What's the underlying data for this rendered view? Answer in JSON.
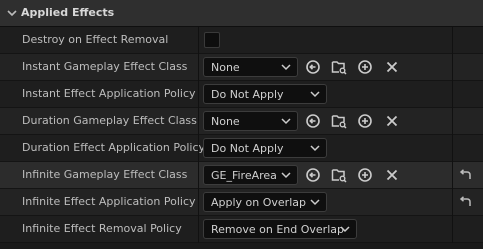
{
  "section": {
    "title": "Applied Effects"
  },
  "rows": [
    {
      "label": "Destroy on Effect Removal"
    },
    {
      "label": "Instant Gameplay Effect Class",
      "value": "None"
    },
    {
      "label": "Instant Effect Application Policy",
      "value": "Do Not Apply"
    },
    {
      "label": "Duration Gameplay Effect Class",
      "value": "None"
    },
    {
      "label": "Duration Effect Application Policy",
      "value": "Do Not Apply"
    },
    {
      "label": "Infinite Gameplay Effect Class",
      "value": "GE_FireArea"
    },
    {
      "label": "Infinite Effect Application Policy",
      "value": "Apply on Overlap"
    },
    {
      "label": "Infinite Effect Removal Policy",
      "value": "Remove on End Overlap"
    }
  ],
  "icons": {
    "collapse": "chevron-down-icon",
    "use_selected": "arrow-left-circle-icon",
    "browse": "folder-search-icon",
    "add": "plus-circle-icon",
    "clear": "close-icon",
    "reset": "reset-arrow-icon"
  }
}
